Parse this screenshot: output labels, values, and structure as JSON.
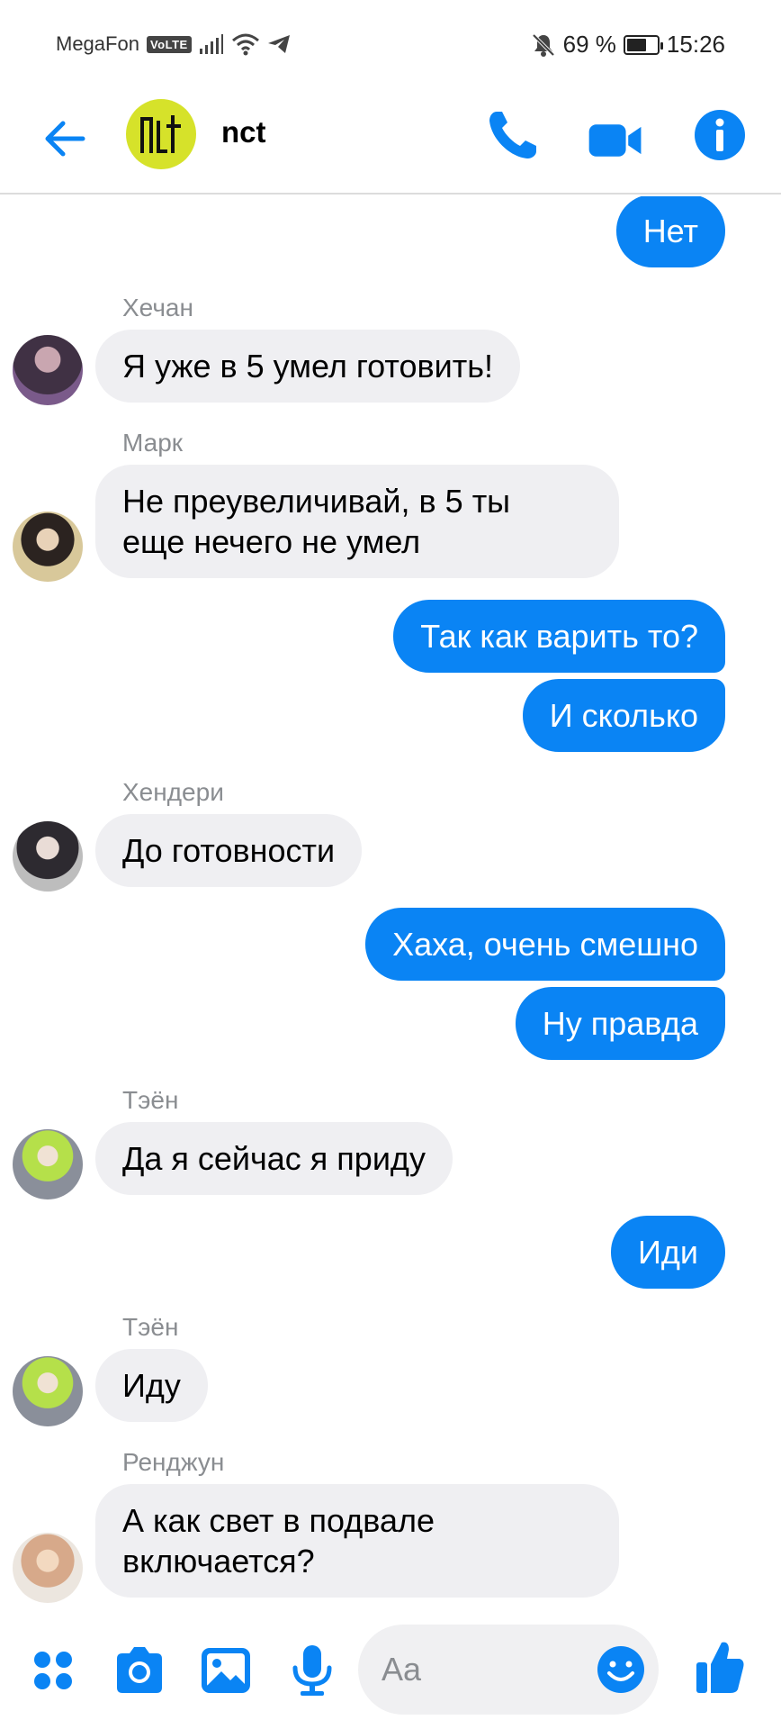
{
  "status_bar": {
    "carrier": "MegaFon",
    "volte": "VoLTE",
    "battery_percent": "69 %",
    "battery_level": 0.69,
    "time": "15:26"
  },
  "header": {
    "title": "nct",
    "icons": [
      "back-arrow-icon",
      "phone-icon",
      "video-camera-icon",
      "info-icon"
    ]
  },
  "messages": [
    {
      "direction": "out",
      "text": "Нет"
    },
    {
      "direction": "in",
      "sender": "Хечан",
      "text": "Я уже в 5 умел готовить!"
    },
    {
      "direction": "in",
      "sender": "Марк",
      "lines": [
        "Не преувеличивай, в 5 ты",
        "еще нечего не умел"
      ]
    },
    {
      "direction": "out",
      "text": "Так как варить то?"
    },
    {
      "direction": "out",
      "text": "И сколько"
    },
    {
      "direction": "in",
      "sender": "Хендери",
      "text": "До готовности"
    },
    {
      "direction": "out",
      "text": "Хаха, очень смешно"
    },
    {
      "direction": "out",
      "text": "Ну правда"
    },
    {
      "direction": "in",
      "sender": "Тэён",
      "text": "Да я сейчас я приду"
    },
    {
      "direction": "out",
      "text": "Иди"
    },
    {
      "direction": "in",
      "sender": "Тэён",
      "text": "Иду"
    },
    {
      "direction": "in",
      "sender": "Ренджун",
      "lines": [
        "А как свет в подвале",
        "включается?"
      ]
    }
  ],
  "composer": {
    "placeholder": "Aa",
    "icons": [
      "apps-grid-icon",
      "camera-icon",
      "gallery-icon",
      "microphone-icon",
      "emoji-icon",
      "thumbs-up-icon"
    ]
  },
  "colors": {
    "accent": "#0a84f4",
    "incoming_bubble": "#efeff2",
    "sender_name": "#8a8d91",
    "group_avatar": "#d6e22a"
  }
}
